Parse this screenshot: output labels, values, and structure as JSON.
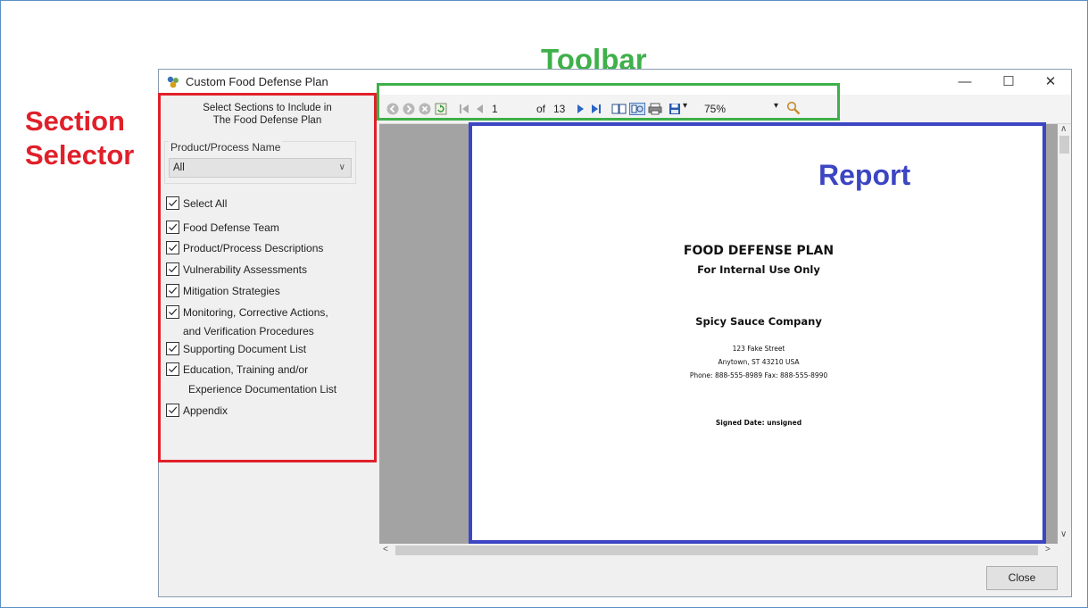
{
  "annotations": {
    "section_selector": "Section Selector",
    "toolbar": "Toolbar",
    "report": "Report"
  },
  "colors": {
    "section_box": "#e0202a",
    "toolbar_box": "#3fb04a",
    "report_box": "#3c45c2"
  },
  "window": {
    "title": "Custom Food Defense Plan",
    "controls": [
      "minimize-icon",
      "maximize-icon",
      "close-icon"
    ]
  },
  "selector": {
    "header_line1": "Select Sections to Include in",
    "header_line2": "The Food Defense Plan",
    "group_label": "Product/Process Name",
    "dropdown_value": "All",
    "items": [
      {
        "label": "Select All",
        "checked": true
      },
      {
        "label": "Food Defense Team",
        "checked": true
      },
      {
        "label": "Product/Process Descriptions",
        "checked": true
      },
      {
        "label": "Vulnerability Assessments",
        "checked": true
      },
      {
        "label": "Mitigation Strategies",
        "checked": true
      },
      {
        "label": "Monitoring, Corrective Actions,",
        "continuation": "and Verification Procedures",
        "checked": true
      },
      {
        "label": "Supporting Document List",
        "checked": true
      },
      {
        "label": "Education, Training and/or",
        "continuation": "Experience Documentation List",
        "checked": true
      },
      {
        "label": "Appendix",
        "checked": true
      }
    ]
  },
  "toolbar": {
    "page_current": "1",
    "page_of": "of",
    "page_total": "13",
    "zoom": "75%",
    "icons": [
      "back-icon",
      "forward-icon",
      "stop-icon",
      "refresh-icon",
      "first-page-icon",
      "previous-page-icon",
      "next-page-icon",
      "last-page-icon",
      "document-map-icon",
      "page-setup-icon",
      "print-icon",
      "save-icon",
      "search-icon"
    ]
  },
  "report": {
    "title": "FOOD DEFENSE PLAN",
    "subtitle": "For Internal Use Only",
    "company": "Spicy Sauce Company",
    "address1": "123 Fake Street",
    "address2": "Anytown, ST 43210 USA",
    "phone": "Phone: 888-555-8989  Fax: 888-555-8990",
    "signed": "Signed Date: unsigned"
  },
  "buttons": {
    "close": "Close"
  }
}
